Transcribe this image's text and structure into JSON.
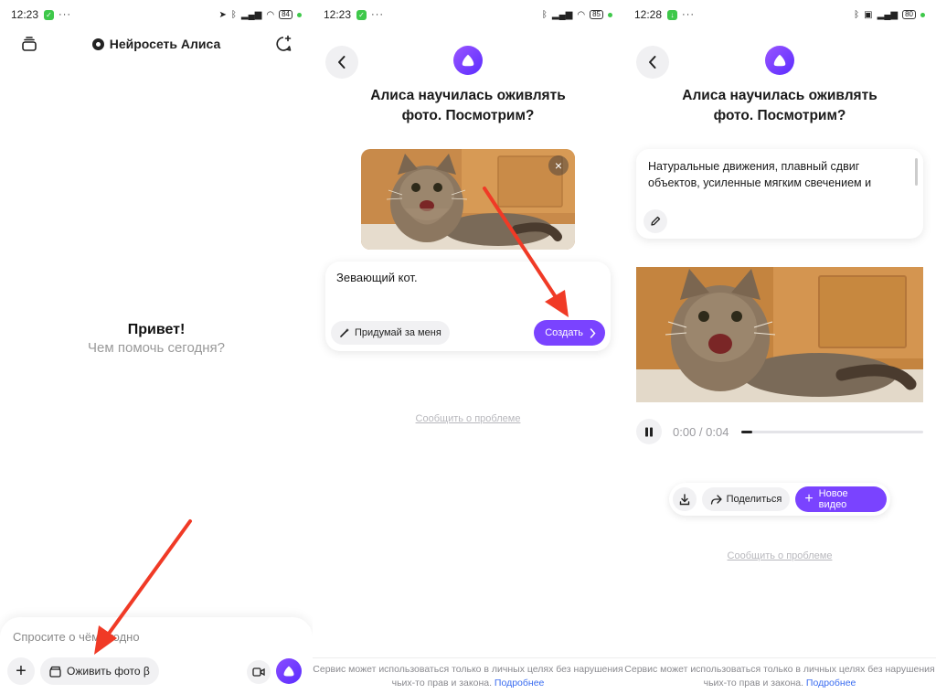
{
  "screen1": {
    "status": {
      "time": "12:23",
      "battery": "84"
    },
    "header_title": "Нейросеть Алиса",
    "greeting_title": "Привет!",
    "greeting_sub": "Чем помочь сегодня?",
    "input_placeholder": "Спросите о чём угодно",
    "animate_button": "Оживить фото β",
    "icons": [
      "stack-icon",
      "new-chat-icon",
      "plus-icon",
      "video-icon",
      "alice-icon"
    ]
  },
  "screen2": {
    "status": {
      "time": "12:23",
      "battery": "85"
    },
    "heading_line1": "Алиса научилась оживлять",
    "heading_line2": "фото. Посмотрим?",
    "prompt_text": "Зевающий кот.",
    "suggest_button": "Придумай за меня",
    "create_button": "Создать",
    "report_link": "Сообщить о проблеме",
    "footer_text": "Сервис может использоваться только в личных целях без нарушения чьих-то прав и закона.",
    "footer_link": "Подробнее"
  },
  "screen3": {
    "status": {
      "time": "12:28",
      "battery": "80"
    },
    "heading_line1": "Алиса научилась оживлять",
    "heading_line2": "фото. Посмотрим?",
    "description": "Натуральные движения, плавный сдвиг объектов, усиленные мягким свечением и эффектами",
    "player_time": "0:00 / 0:04",
    "progress": 0.06,
    "share_button": "Поделиться",
    "new_video_button": "Новое видео",
    "report_link": "Сообщить о проблеме",
    "footer_text": "Сервис может использоваться только в личных целях без нарушения чьих-то прав и закона.",
    "footer_link": "Подробнее"
  },
  "colors": {
    "accent": "#7a43ff",
    "arrow": "#f03a26"
  }
}
